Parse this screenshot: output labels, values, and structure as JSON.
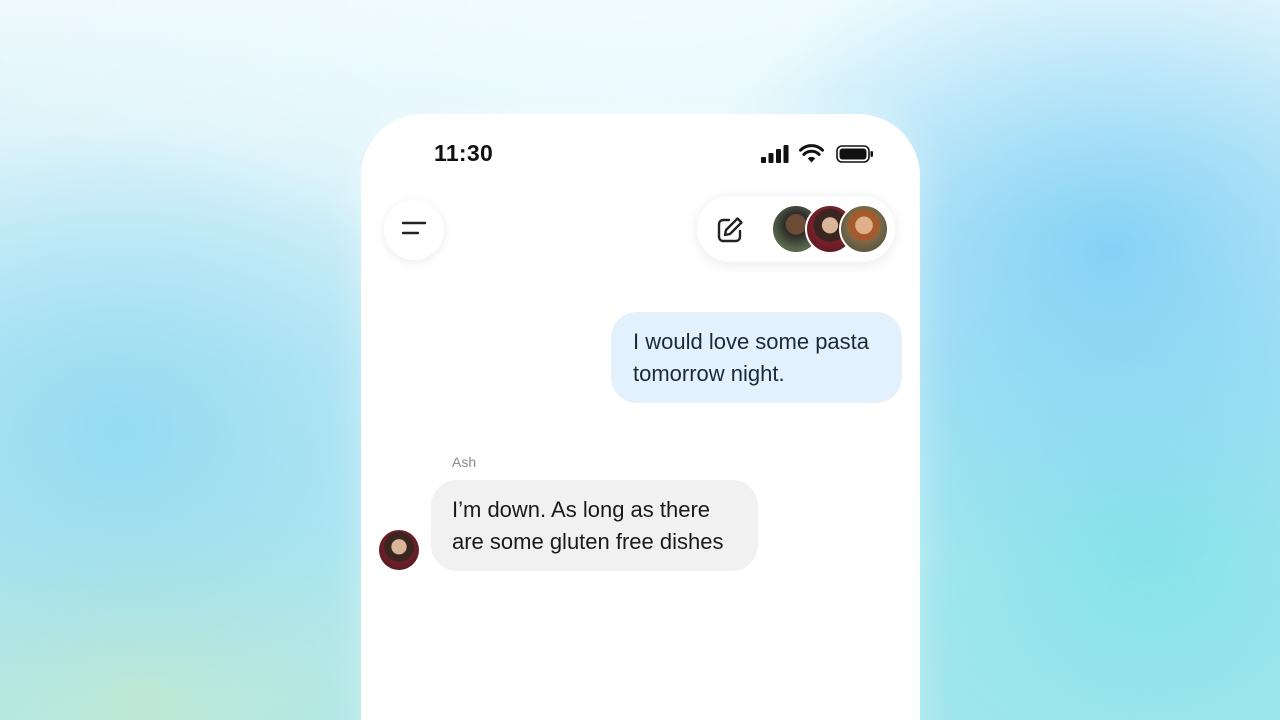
{
  "status_bar": {
    "time": "11:30",
    "icons": [
      "signal-icon",
      "wifi-icon",
      "battery-icon"
    ]
  },
  "header": {
    "menu_icon": "menu-icon",
    "compose_icon": "compose-icon",
    "participants": [
      "avatar",
      "avatar",
      "avatar"
    ]
  },
  "messages": [
    {
      "direction": "outgoing",
      "text": "I would love some pasta tomorrow night."
    },
    {
      "direction": "incoming",
      "sender": "Ash",
      "text": "I’m down. As long as there are some gluten free dishes"
    }
  ],
  "colors": {
    "outgoing_bubble": "#e3f1fd",
    "incoming_bubble": "#f1f1f2",
    "sender_name": "#8a8a8a"
  }
}
